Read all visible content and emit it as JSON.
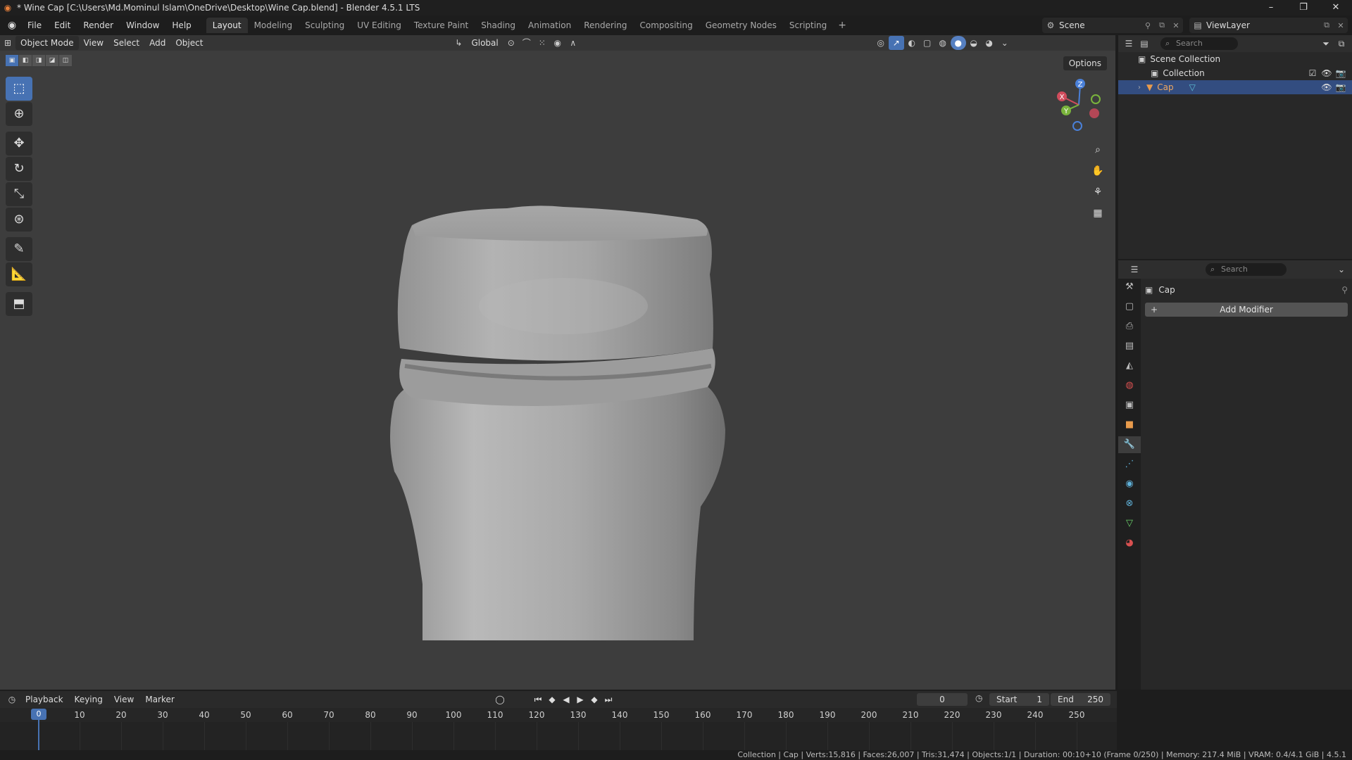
{
  "window": {
    "title": "* Wine Cap [C:\\Users\\Md.Mominul Islam\\OneDrive\\Desktop\\Wine Cap.blend] - Blender 4.5.1 LTS",
    "minimize": "–",
    "maximize": "❐",
    "close": "✕"
  },
  "menu": [
    "File",
    "Edit",
    "Render",
    "Window",
    "Help"
  ],
  "workspaces": [
    "Layout",
    "Modeling",
    "Sculpting",
    "UV Editing",
    "Texture Paint",
    "Shading",
    "Animation",
    "Rendering",
    "Compositing",
    "Geometry Nodes",
    "Scripting"
  ],
  "active_workspace": "Layout",
  "scene": {
    "label": "Scene"
  },
  "view_layer": {
    "label": "ViewLayer"
  },
  "viewport": {
    "mode": "Object Mode",
    "menus": [
      "View",
      "Select",
      "Add",
      "Object"
    ],
    "orientation": "Global",
    "options_label": "Options"
  },
  "gizmo": {
    "x": "X",
    "y": "Y",
    "z": "Z"
  },
  "outliner": {
    "search_placeholder": "Search",
    "scene_collection": "Scene Collection",
    "collection": "Collection",
    "object": "Cap"
  },
  "properties": {
    "search_placeholder": "Search",
    "object_name": "Cap",
    "add_modifier": "Add Modifier"
  },
  "timeline": {
    "menus": [
      "Playback",
      "Keying",
      "View",
      "Marker"
    ],
    "current_frame": "0",
    "start_label": "Start",
    "start_value": "1",
    "end_label": "End",
    "end_value": "250",
    "ticks": [
      "0",
      "10",
      "20",
      "30",
      "40",
      "50",
      "60",
      "70",
      "80",
      "90",
      "100",
      "110",
      "120",
      "130",
      "140",
      "150",
      "160",
      "170",
      "180",
      "190",
      "200",
      "210",
      "220",
      "230",
      "240",
      "250"
    ]
  },
  "status": {
    "text": "Collection | Cap | Verts:15,816 | Faces:26,007 | Tris:31,474 | Objects:1/1 | Duration: 00:10+10 (Frame 0/250) | Memory: 217.4 MiB | VRAM: 0.4/4.1 GiB | 4.5.1"
  }
}
